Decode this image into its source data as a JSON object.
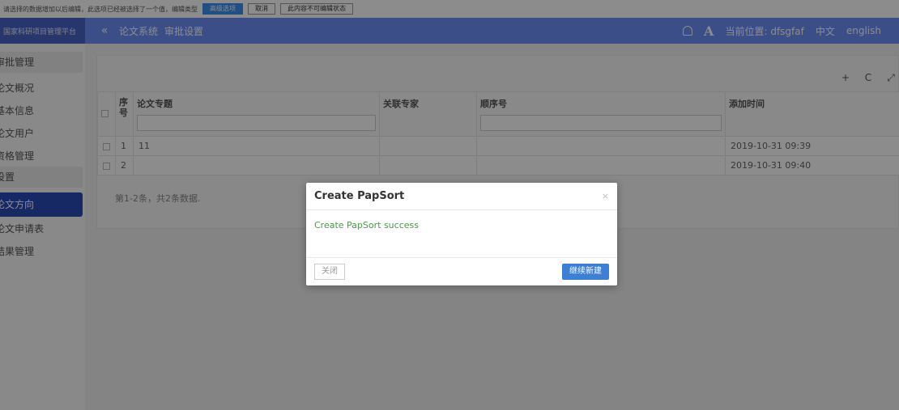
{
  "topbar": {
    "message": "请选择的数据增加以后编辑，此选项已经被选择了一个值，编辑类型",
    "buttons": [
      "高级选项",
      "取消",
      "此内容不可编辑状态"
    ]
  },
  "header": {
    "logo_text": "国家科研项目管理平台",
    "collapse_icon": "«",
    "breadcrumb": [
      "论文系统",
      "审批设置"
    ],
    "location_label": "当前位置: dfsgfaf",
    "lang_zh": "中文",
    "lang_en": "english",
    "font_glyph": "A"
  },
  "sidebar": {
    "items": [
      {
        "label": "审批管理",
        "kind": "group"
      },
      {
        "label": "论文概况",
        "kind": "item"
      },
      {
        "label": "基本信息",
        "kind": "item"
      },
      {
        "label": "论文用户",
        "kind": "item"
      },
      {
        "label": "资格管理",
        "kind": "item"
      },
      {
        "label": "设置",
        "kind": "group"
      },
      {
        "label": "论文方向",
        "kind": "active"
      },
      {
        "label": "论文申请表",
        "kind": "item"
      },
      {
        "label": "结果管理",
        "kind": "item"
      }
    ]
  },
  "toolbar": {
    "icons": [
      "plus-icon",
      "refresh-icon",
      "expand-icon"
    ],
    "glyphs": [
      "+",
      "C",
      "⤢"
    ]
  },
  "table": {
    "headers": {
      "seq": "序号",
      "topic": "论文专题",
      "expert": "关联专家",
      "order": "顺序号",
      "added": "添加时间"
    },
    "rows": [
      {
        "seq": "1",
        "topic": "11",
        "expert": "",
        "order": "",
        "added": "2019-10-31 09:39"
      },
      {
        "seq": "2",
        "topic": "",
        "expert": "",
        "order": "",
        "added": "2019-10-31 09:40"
      }
    ],
    "summary": "第1-2条，共2条数据."
  },
  "modal": {
    "title": "Create PapSort",
    "close_glyph": "×",
    "message": "Create PapSort success",
    "close_label": "关闭",
    "continue_label": "继续新建"
  }
}
